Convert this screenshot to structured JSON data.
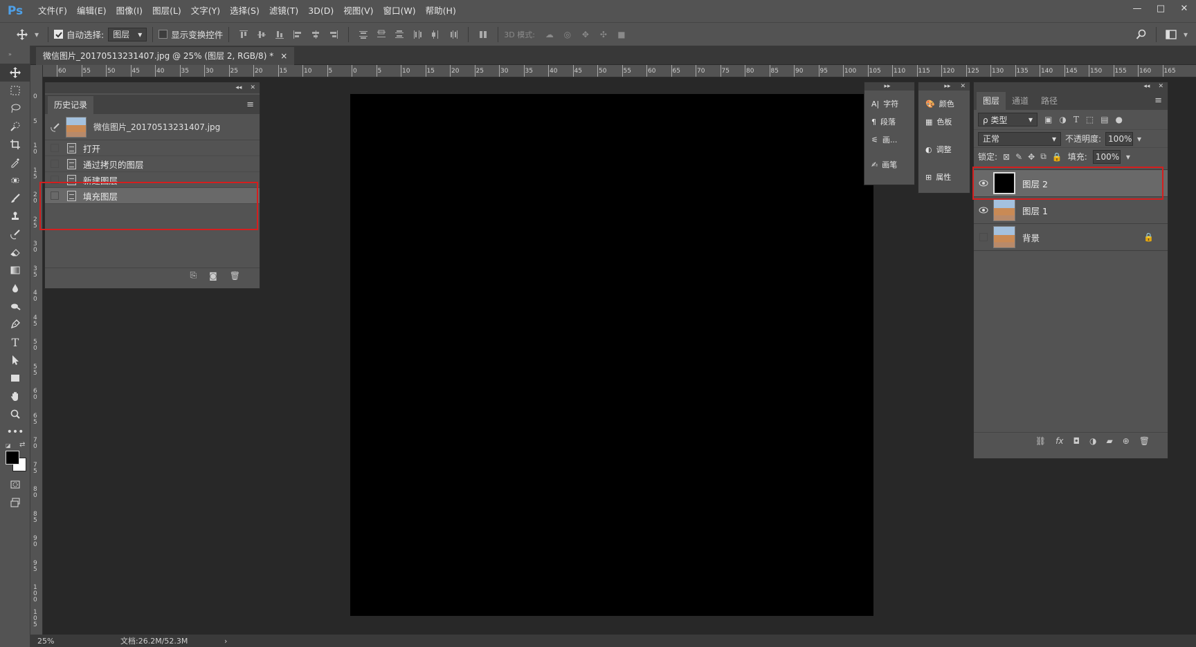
{
  "app": {
    "logo": "Ps"
  },
  "menu": [
    "文件(F)",
    "编辑(E)",
    "图像(I)",
    "图层(L)",
    "文字(Y)",
    "选择(S)",
    "滤镜(T)",
    "3D(D)",
    "视图(V)",
    "窗口(W)",
    "帮助(H)"
  ],
  "options": {
    "auto_select_label": "自动选择:",
    "auto_select_value": "图层",
    "show_transform_label": "显示变换控件",
    "mode_3d_label": "3D 模式:"
  },
  "document": {
    "tab_title": "微信图片_20170513231407.jpg @ 25% (图层 2, RGB/8) *",
    "close": "×"
  },
  "ruler": {
    "h": [
      "60",
      "55",
      "50",
      "45",
      "40",
      "35",
      "30",
      "25",
      "20",
      "15",
      "10",
      "5",
      "0",
      "5",
      "10",
      "15",
      "20",
      "25",
      "30",
      "35",
      "40",
      "45",
      "50",
      "55",
      "60",
      "65",
      "70",
      "75",
      "80",
      "85",
      "90",
      "95",
      "100",
      "105",
      "110",
      "115",
      "120",
      "125",
      "130",
      "135",
      "140",
      "145",
      "150",
      "155",
      "160",
      "165"
    ],
    "v": [
      "0",
      "5",
      "1 0",
      "1 5",
      "2 0",
      "2 5",
      "3 0",
      "3 5",
      "4 0",
      "4 5",
      "5 0",
      "5 5",
      "6 0",
      "6 5",
      "7 0",
      "7 5",
      "8 0",
      "8 5",
      "9 0",
      "9 5",
      "1 0 0",
      "1 0 5"
    ]
  },
  "history": {
    "tab": "历史记录",
    "snapshot": "微信图片_20170513231407.jpg",
    "steps": [
      "打开",
      "通过拷贝的图层",
      "新建图层",
      "填充图层"
    ]
  },
  "mini_panel_a": [
    "字符",
    "段落",
    "画...",
    "画笔"
  ],
  "mini_panel_b": [
    "颜色",
    "色板",
    "调整",
    "属性"
  ],
  "layers": {
    "tabs": [
      "图层",
      "通道",
      "路径"
    ],
    "filter_label": "ρ 类型",
    "blend_mode": "正常",
    "opacity_label": "不透明度:",
    "opacity_value": "100%",
    "lock_label": "锁定:",
    "fill_label": "填充:",
    "fill_value": "100%",
    "items": [
      {
        "name": "图层 2",
        "visible": true
      },
      {
        "name": "图层 1",
        "visible": true
      },
      {
        "name": "背景",
        "visible": false
      }
    ]
  },
  "status": {
    "zoom": "25%",
    "doc_size": "文档:26.2M/52.3M"
  },
  "colors": {
    "highlight": "#d51e1e",
    "canvas": "#000000"
  }
}
